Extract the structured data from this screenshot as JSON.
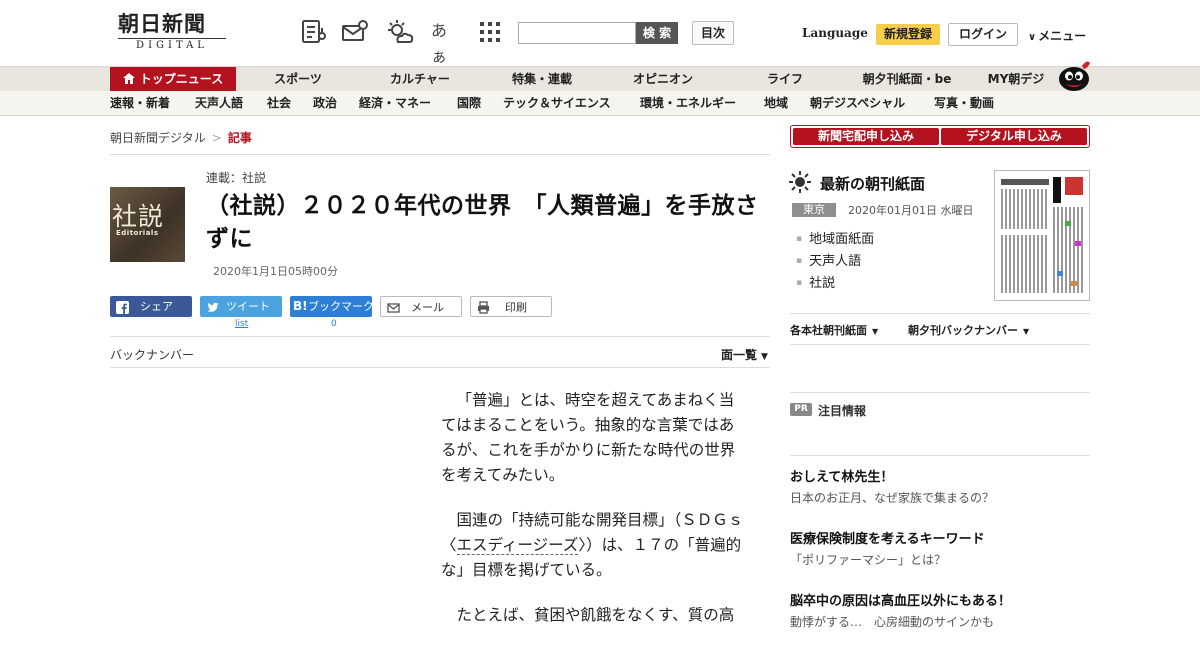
{
  "header": {
    "logo_jp": "朝日新聞",
    "logo_en": "DIGITAL",
    "font_size_glyph": "あぁ",
    "search_button": "検 索",
    "search_placeholder": "",
    "index_button": "目次",
    "language_link": "Language",
    "register_button": "新規登録",
    "login_button": "ログイン",
    "menu_button": "メニュー",
    "icons": [
      "newspaper-icon",
      "mail-icon",
      "weather-icon",
      "font-size-icon",
      "grid-menu-icon"
    ]
  },
  "nav_primary": [
    {
      "label": "トップニュース",
      "active": true
    },
    {
      "label": "スポーツ"
    },
    {
      "label": "カルチャー"
    },
    {
      "label": "特集・連載"
    },
    {
      "label": "オピニオン"
    },
    {
      "label": "ライフ"
    },
    {
      "label": "朝夕刊紙面・be"
    },
    {
      "label": "MY朝デジ"
    }
  ],
  "nav_secondary": [
    "速報・新着",
    "天声人語",
    "社会",
    "政治",
    "経済・マネー",
    "国際",
    "テック＆サイエンス",
    "環境・エネルギー",
    "地域",
    "朝デジスペシャル",
    "写真・動画"
  ],
  "breadcrumb": {
    "home": "朝日新聞デジタル",
    "separator": ">",
    "current": "記事"
  },
  "article": {
    "image_kanji": "社説",
    "image_en": "Editorials",
    "category": "連載：社説",
    "title": "（社説）２０２０年代の世界　「人類普遍」を手放さずに",
    "date": "2020年1月1日05時00分",
    "paragraphs": [
      "「普遍」とは、時空を超えてあまねく当てはまることをいう。抽象的な言葉ではあるが、これを手がかりに新たな時代の世界を考えてみたい。",
      "たとえば、貧困や飢餓をなくす、質の高"
    ],
    "p2_before": "国連の「持続可能な開発目標」（ＳＤＧｓ〈",
    "p2_link": "エスディージーズ",
    "p2_after": "〉）は、１７の「普遍的な」目標を掲げている。"
  },
  "share": {
    "facebook": "シェア",
    "twitter": "ツイート",
    "hatena": "ブックマーク",
    "mail": "メール",
    "print": "印刷",
    "twitter_count": "list",
    "hatena_count": "0"
  },
  "backnumber": {
    "label": "バックナンバー",
    "list_label": "面一覧"
  },
  "sidebar": {
    "subscribe_paper": "新聞宅配申し込み",
    "subscribe_digital": "デジタル申し込み",
    "paper_title": "最新の朝刊紙面",
    "region": "東京",
    "paper_date": "2020年01月01日 水曜日",
    "paper_links": [
      "地域面紙面",
      "天声人語",
      "社説"
    ],
    "dropdown_regional": "各本社朝刊紙面",
    "dropdown_backnumber": "朝夕刊バックナンバー",
    "pr_badge": "PR",
    "pr_title": "注目情報",
    "promos": [
      {
        "title": "おしえて林先生！",
        "sub": "日本のお正月、なぜ家族で集まるの？"
      },
      {
        "title": "医療保険制度を考えるキーワード",
        "sub": "「ポリファーマシー」とは？"
      },
      {
        "title": "脳卒中の原因は高血圧以外にもある！",
        "sub": "動悸がする…　心房細動のサインかも"
      }
    ]
  },
  "colors": {
    "brand_red": "#b3121e",
    "facebook": "#3b5998",
    "twitter": "#4aa3df",
    "hatena": "#2c7fd4",
    "register": "#f5cf4a"
  }
}
